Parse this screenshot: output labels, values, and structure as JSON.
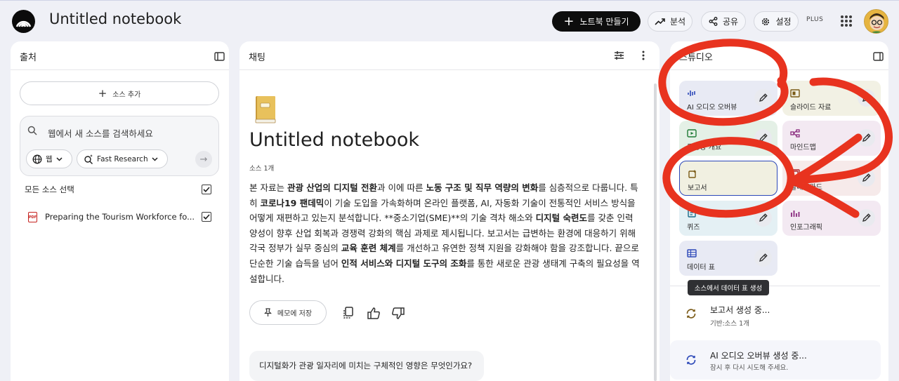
{
  "header": {
    "notebook_title": "Untitled notebook",
    "create_label": "노트북 만들기",
    "analytics_label": "분석",
    "share_label": "공유",
    "settings_label": "설정",
    "plan_badge": "PLUS"
  },
  "sources": {
    "title": "출처",
    "add_label": "소스 추가",
    "search_placeholder": "웹에서 새 소스를 검색하세요",
    "chip_web": "웹",
    "chip_research": "Fast Research",
    "select_all": "모든 소스 선택",
    "items": [
      {
        "name": "Preparing the Tourism Workforce fo...",
        "type": "PDF",
        "checked": true
      }
    ]
  },
  "chat": {
    "title": "채팅",
    "notebook_title": "Untitled notebook",
    "source_count": "소스 1개",
    "memo_label": "메모에 저장",
    "suggestion": "디지털화가 관광 일자리에 미치는 구체적인 영향은 무엇인가요?",
    "summary": [
      {
        "t": "본 자료는 "
      },
      {
        "t": "관광 산업의 디지털 전환",
        "b": true
      },
      {
        "t": "과 이에 따른 "
      },
      {
        "t": "노동 구조 및 직무 역량의 변화",
        "b": true
      },
      {
        "t": "를 심층적으로 다룹니다. 특히 "
      },
      {
        "t": "코로나19 팬데믹",
        "b": true
      },
      {
        "t": "이 기술 도입을 가속화하며 온라인 플랫폼, AI, 자동화 기술이 전통적인 서비스 방식을 어떻게 재편하고 있는지 분석합니다. **중소기업(SME)**의 기술 격차 해소와 "
      },
      {
        "t": "디지털 숙련도",
        "b": true
      },
      {
        "t": "를 갖춘 인력 양성이 향후 산업 회복과 경쟁력 강화의 핵심 과제로 제시됩니다. 보고서는 급변하는 환경에 대응하기 위해 각국 정부가 실무 중심의 "
      },
      {
        "t": "교육 훈련 체계",
        "b": true
      },
      {
        "t": "를 개선하고 유연한 정책 지원을 강화해야 함을 강조합니다. 끝으로 단순한 기술 습득을 넘어 "
      },
      {
        "t": "인적 서비스와 디지털 도구의 조화",
        "b": true
      },
      {
        "t": "를 통한 새로운 관광 생태계 구축의 필요성을 역설합니다."
      }
    ]
  },
  "studio": {
    "title": "스튜디오",
    "tiles": [
      {
        "label": "AI 오디오 오버뷰",
        "icon": "audio-icon",
        "bg": "#e8eaf4",
        "editable": true
      },
      {
        "label": "슬라이드 자료",
        "icon": "slides-icon",
        "bg": "#f2f1e4",
        "editable": true
      },
      {
        "label": "동영상 개요",
        "icon": "video-icon",
        "bg": "#e4f0e6",
        "editable": true
      },
      {
        "label": "마인드맵",
        "icon": "mindmap-icon",
        "bg": "#f3e9f2",
        "editable": true
      },
      {
        "label": "보고서",
        "icon": "report-icon",
        "bg": "#f1f0e1",
        "editable": true
      },
      {
        "label": "플래시카드",
        "icon": "flashcard-icon",
        "bg": "#f6eaea",
        "editable": true
      },
      {
        "label": "퀴즈",
        "icon": "quiz-icon",
        "bg": "#e4f0f4",
        "editable": true
      },
      {
        "label": "인포그래픽",
        "icon": "infographic-icon",
        "bg": "#f3e9f2",
        "editable": true
      },
      {
        "label": "데이터 표",
        "icon": "table-icon",
        "bg": "#e8eaf4",
        "editable": true
      }
    ],
    "tooltip": "소스에서 데이터 표 생성",
    "generating": [
      {
        "title": "보고서 생성 중...",
        "subtitle": "기반:소스 1개"
      },
      {
        "title": "AI 오디오 오버뷰 생성 중...",
        "subtitle": "잠시 후 다시 시도해 주세요."
      }
    ]
  },
  "colors": {
    "annotation_red": "#e8331f",
    "page_bg": "#eff0f6",
    "selected_border": "#2c48b8"
  }
}
